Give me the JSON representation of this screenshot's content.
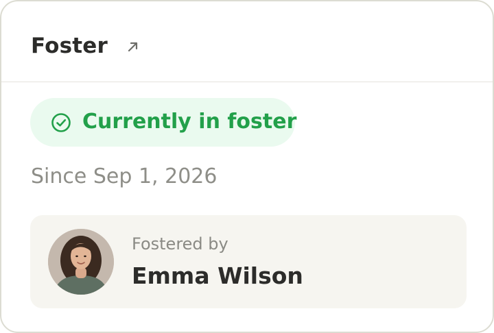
{
  "card": {
    "title": "Foster",
    "open_icon": "arrow-up-right-icon"
  },
  "status": {
    "icon": "check-circle-icon",
    "label": "Currently in foster",
    "color": "#22a04a",
    "background": "#eafaef"
  },
  "since_text": "Since Sep 1, 2026",
  "foster": {
    "label": "Fostered by",
    "name": "Emma Wilson",
    "avatar": "person-avatar"
  }
}
